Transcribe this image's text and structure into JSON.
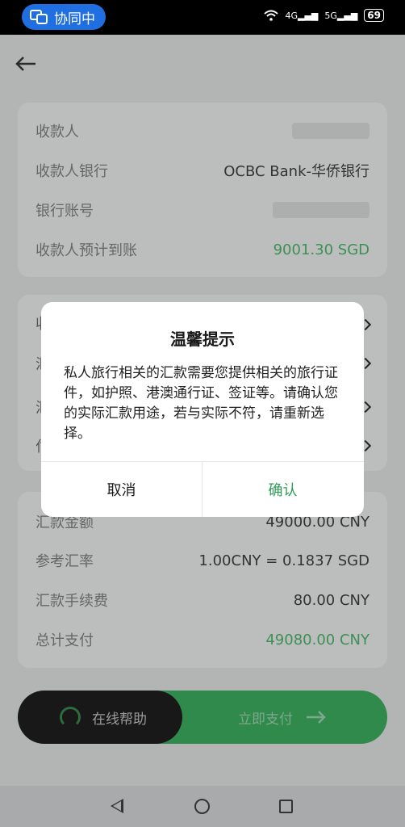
{
  "status_bar": {
    "collab_label": "协同中",
    "network1": "4G",
    "network2": "5G",
    "battery": "69"
  },
  "transfer": {
    "payee_label": "收款人",
    "bank_label": "收款人银行",
    "bank_value": "OCBC Bank-华侨银行",
    "account_label": "银行账号",
    "expected_label": "收款人预计到账",
    "expected_value": "9001.30 SGD"
  },
  "middle_fragments": [
    "收",
    "汇",
    "汇",
    "付"
  ],
  "amounts": {
    "amount_label": "汇款金额",
    "amount_value": "49000.00 CNY",
    "rate_label": "参考汇率",
    "rate_value": "1.00CNY = 0.1837 SGD",
    "fee_label": "汇款手续费",
    "fee_value": "80.00 CNY",
    "total_label": "总计支付",
    "total_value": "49080.00 CNY"
  },
  "footer": {
    "help_label": "在线帮助",
    "pay_label": "立即支付"
  },
  "dialog": {
    "title": "温馨提示",
    "body": "私人旅行相关的汇款需要您提供相关的旅行证件，如护照、港澳通行证、签证等。请确认您的实际汇款用途，若与实际不符，请重新选择。",
    "cancel_label": "取消",
    "confirm_label": "确认"
  }
}
